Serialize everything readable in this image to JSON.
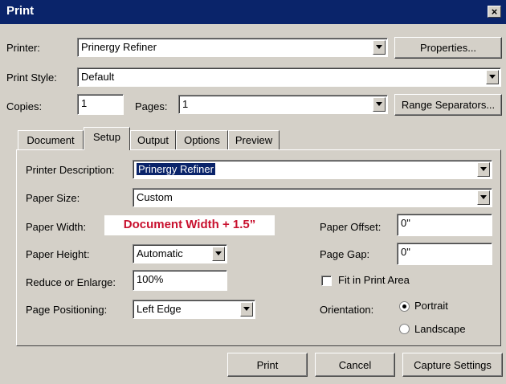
{
  "window": {
    "title": "Print",
    "close_glyph": "×"
  },
  "printer": {
    "label": "Printer:",
    "value": "Prinergy Refiner",
    "properties_label": "Properties..."
  },
  "print_style": {
    "label": "Print Style:",
    "value": "Default"
  },
  "copies": {
    "label": "Copies:",
    "value": "1"
  },
  "pages": {
    "label": "Pages:",
    "value": "1",
    "range_separators_label": "Range Separators..."
  },
  "tabs": [
    {
      "label": "Document"
    },
    {
      "label": "Setup"
    },
    {
      "label": "Output"
    },
    {
      "label": "Options"
    },
    {
      "label": "Preview"
    }
  ],
  "active_tab": "Setup",
  "setup": {
    "printer_description": {
      "label": "Printer Description:",
      "value": "Prinergy Refiner"
    },
    "paper_size": {
      "label": "Paper Size:",
      "value": "Custom"
    },
    "paper_width": {
      "label": "Paper Width:"
    },
    "paper_height": {
      "label": "Paper Height:",
      "value": "Automatic"
    },
    "reduce_enlarge": {
      "label": "Reduce or Enlarge:",
      "value": "100%"
    },
    "page_positioning": {
      "label": "Page Positioning:",
      "value": "Left Edge"
    },
    "paper_offset": {
      "label": "Paper Offset:",
      "value": "0\""
    },
    "page_gap": {
      "label": "Page Gap:",
      "value": "0\""
    },
    "fit_in_print_area": {
      "label": "Fit in Print Area",
      "checked": false
    },
    "orientation": {
      "label": "Orientation:",
      "options": [
        "Portrait",
        "Landscape"
      ],
      "selected": "Portrait"
    }
  },
  "annotation": {
    "part1": "Document Width",
    "part2": " + 1.5”"
  },
  "footer": {
    "print_label": "Print",
    "cancel_label": "Cancel",
    "capture_label": "Capture Settings"
  },
  "colors": {
    "titlebar": "#0a246a",
    "dialog_bg": "#d4d0c8",
    "annotation_text": "#c8102e"
  }
}
